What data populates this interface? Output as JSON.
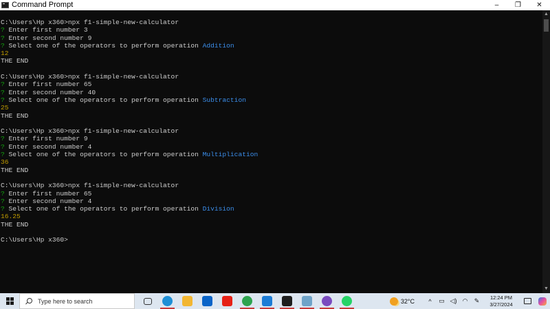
{
  "window": {
    "title": "Command Prompt",
    "minimize_glyph": "–",
    "maximize_glyph": "❐",
    "close_glyph": "✕"
  },
  "console": {
    "lines": [
      {
        "segments": [
          {
            "t": "C:\\Users\\Hp x360>npx f1-simple-new-calculator",
            "c": "text"
          }
        ]
      },
      {
        "segments": [
          {
            "t": "?",
            "c": "q"
          },
          {
            "t": " Enter first number 3",
            "c": "text"
          }
        ]
      },
      {
        "segments": [
          {
            "t": "?",
            "c": "q"
          },
          {
            "t": " Enter second number 9",
            "c": "text"
          }
        ]
      },
      {
        "segments": [
          {
            "t": "?",
            "c": "q"
          },
          {
            "t": " Select one of the operators to perform operation ",
            "c": "text"
          },
          {
            "t": "Addition",
            "c": "op"
          }
        ]
      },
      {
        "segments": [
          {
            "t": "12",
            "c": "res"
          }
        ]
      },
      {
        "segments": [
          {
            "t": "THE END",
            "c": "text"
          }
        ]
      },
      {
        "segments": [
          {
            "t": "",
            "c": "text"
          }
        ]
      },
      {
        "segments": [
          {
            "t": "C:\\Users\\Hp x360>npx f1-simple-new-calculator",
            "c": "text"
          }
        ]
      },
      {
        "segments": [
          {
            "t": "?",
            "c": "q"
          },
          {
            "t": " Enter first number 65",
            "c": "text"
          }
        ]
      },
      {
        "segments": [
          {
            "t": "?",
            "c": "q"
          },
          {
            "t": " Enter second number 40",
            "c": "text"
          }
        ]
      },
      {
        "segments": [
          {
            "t": "?",
            "c": "q"
          },
          {
            "t": " Select one of the operators to perform operation ",
            "c": "text"
          },
          {
            "t": "Subtraction",
            "c": "op"
          }
        ]
      },
      {
        "segments": [
          {
            "t": "25",
            "c": "res"
          }
        ]
      },
      {
        "segments": [
          {
            "t": "THE END",
            "c": "text"
          }
        ]
      },
      {
        "segments": [
          {
            "t": "",
            "c": "text"
          }
        ]
      },
      {
        "segments": [
          {
            "t": "C:\\Users\\Hp x360>npx f1-simple-new-calculator",
            "c": "text"
          }
        ]
      },
      {
        "segments": [
          {
            "t": "?",
            "c": "q"
          },
          {
            "t": " Enter first number 9",
            "c": "text"
          }
        ]
      },
      {
        "segments": [
          {
            "t": "?",
            "c": "q"
          },
          {
            "t": " Enter second number 4",
            "c": "text"
          }
        ]
      },
      {
        "segments": [
          {
            "t": "?",
            "c": "q"
          },
          {
            "t": " Select one of the operators to perform operation ",
            "c": "text"
          },
          {
            "t": "Multiplication",
            "c": "op"
          }
        ]
      },
      {
        "segments": [
          {
            "t": "36",
            "c": "res"
          }
        ]
      },
      {
        "segments": [
          {
            "t": "THE END",
            "c": "text"
          }
        ]
      },
      {
        "segments": [
          {
            "t": "",
            "c": "text"
          }
        ]
      },
      {
        "segments": [
          {
            "t": "C:\\Users\\Hp x360>npx f1-simple-new-calculator",
            "c": "text"
          }
        ]
      },
      {
        "segments": [
          {
            "t": "?",
            "c": "q"
          },
          {
            "t": " Enter first number 65",
            "c": "text"
          }
        ]
      },
      {
        "segments": [
          {
            "t": "?",
            "c": "q"
          },
          {
            "t": " Enter second number 4",
            "c": "text"
          }
        ]
      },
      {
        "segments": [
          {
            "t": "?",
            "c": "q"
          },
          {
            "t": " Select one of the operators to perform operation ",
            "c": "text"
          },
          {
            "t": "Division",
            "c": "op"
          }
        ]
      },
      {
        "segments": [
          {
            "t": "16.25",
            "c": "res"
          }
        ]
      },
      {
        "segments": [
          {
            "t": "THE END",
            "c": "text"
          }
        ]
      },
      {
        "segments": [
          {
            "t": "",
            "c": "text"
          }
        ]
      },
      {
        "segments": [
          {
            "t": "C:\\Users\\Hp x360>",
            "c": "text"
          }
        ]
      }
    ]
  },
  "colors": {
    "console_bg": "#0c0c0c",
    "console_text": "#cccccc",
    "prompt_question": "#13a10e",
    "operator_choice": "#3b8eea",
    "result": "#c19c00",
    "taskbar_bg": "#dde6f0"
  },
  "taskbar": {
    "search_placeholder": "Type here to search",
    "apps": [
      {
        "name": "task-view-icon",
        "color": "#333333",
        "running": false
      },
      {
        "name": "edge-icon",
        "color": "#1f8fd6",
        "running": true
      },
      {
        "name": "file-explorer-icon",
        "color": "#f2b632",
        "running": false
      },
      {
        "name": "mail-icon",
        "color": "#0a64c8",
        "running": false
      },
      {
        "name": "youtube-icon",
        "color": "#e62117",
        "running": false
      },
      {
        "name": "chrome-icon",
        "color": "#2ea44f",
        "running": true
      },
      {
        "name": "vscode-icon",
        "color": "#1c7cd6",
        "running": true
      },
      {
        "name": "command-prompt-icon",
        "color": "#1e1e1e",
        "running": true
      },
      {
        "name": "app-window-icon",
        "color": "#6fa3c8",
        "running": true
      },
      {
        "name": "purple-app-icon",
        "color": "#7a4bbf",
        "running": true
      },
      {
        "name": "whatsapp-icon",
        "color": "#25d366",
        "running": true
      }
    ],
    "tray": {
      "temperature": "32°C",
      "chevron_glyph": "^",
      "clock_time": "12:24 PM",
      "clock_date": "3/27/2024"
    }
  }
}
